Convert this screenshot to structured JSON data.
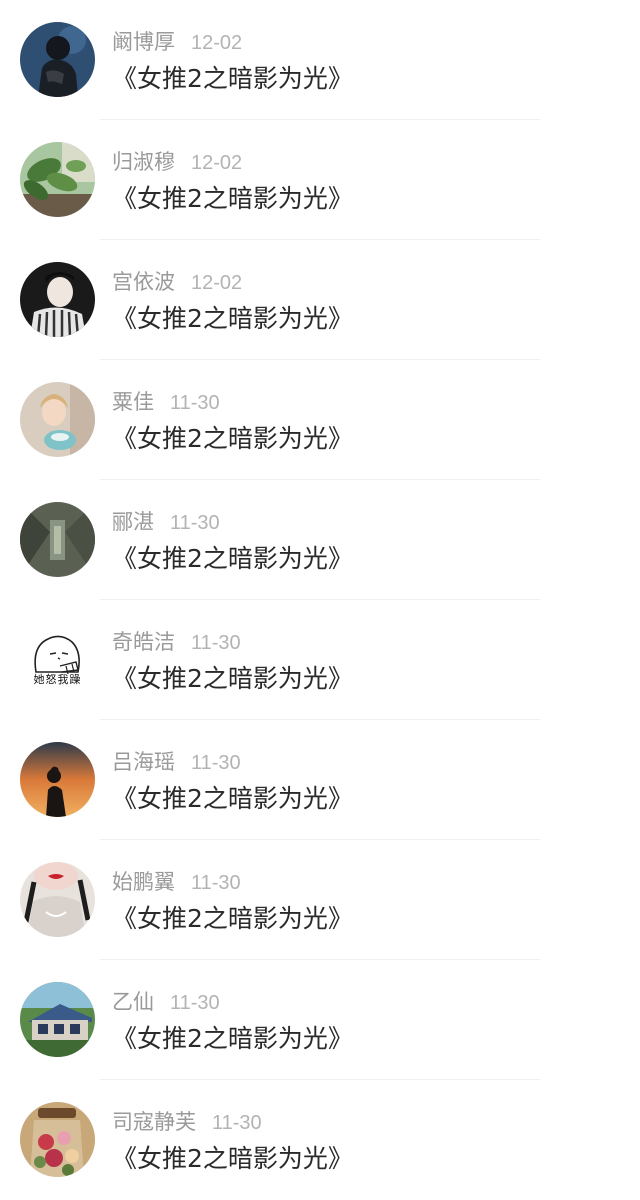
{
  "items": [
    {
      "name": "阚博厚",
      "date": "12-02",
      "title": "《女推2之暗影为光》"
    },
    {
      "name": "归淑穆",
      "date": "12-02",
      "title": "《女推2之暗影为光》"
    },
    {
      "name": "宫依波",
      "date": "12-02",
      "title": "《女推2之暗影为光》"
    },
    {
      "name": "粟佳",
      "date": "11-30",
      "title": "《女推2之暗影为光》"
    },
    {
      "name": "郦湛",
      "date": "11-30",
      "title": "《女推2之暗影为光》"
    },
    {
      "name": "奇皓洁",
      "date": "11-30",
      "title": "《女推2之暗影为光》",
      "avatar_text": "她怒我躁"
    },
    {
      "name": "吕海瑶",
      "date": "11-30",
      "title": "《女推2之暗影为光》"
    },
    {
      "name": "始鹏翼",
      "date": "11-30",
      "title": "《女推2之暗影为光》"
    },
    {
      "name": "乙仙",
      "date": "11-30",
      "title": "《女推2之暗影为光》"
    },
    {
      "name": "司寇静芙",
      "date": "11-30",
      "title": "《女推2之暗影为光》"
    }
  ]
}
